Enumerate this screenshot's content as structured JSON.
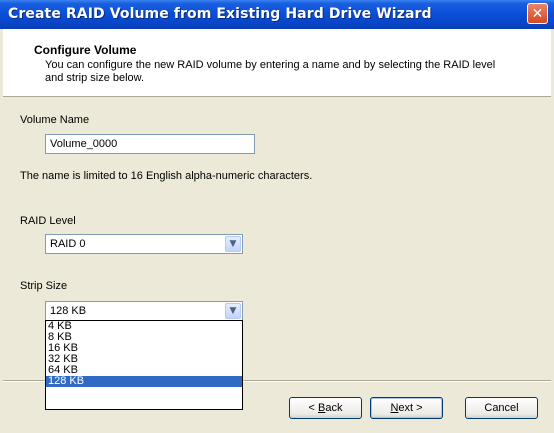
{
  "window": {
    "title": "Create RAID Volume from Existing Hard Drive Wizard",
    "close_glyph": "✕"
  },
  "header": {
    "title": "Configure Volume",
    "description": "You can configure the new RAID volume by entering a name and by selecting the RAID level and strip size below."
  },
  "volume_name": {
    "label": "Volume Name",
    "value": "Volume_0000",
    "hint": "The name is limited to 16 English alpha-numeric characters."
  },
  "raid_level": {
    "label": "RAID Level",
    "selected": "RAID 0",
    "arrow": "▼"
  },
  "strip_size": {
    "label": "Strip Size",
    "selected": "128 KB",
    "arrow": "▼",
    "options": [
      "4 KB",
      "8 KB",
      "16 KB",
      "32 KB",
      "64 KB",
      "128 KB"
    ],
    "highlighted": "128 KB"
  },
  "buttons": {
    "back_prefix": "< ",
    "back_key": "B",
    "back_rest": "ack",
    "next_key": "N",
    "next_rest": "ext >",
    "cancel": "Cancel"
  },
  "colors": {
    "titlebar": "#0a4fd8",
    "selection": "#316ac5",
    "dialog_bg": "#ece9d8"
  }
}
